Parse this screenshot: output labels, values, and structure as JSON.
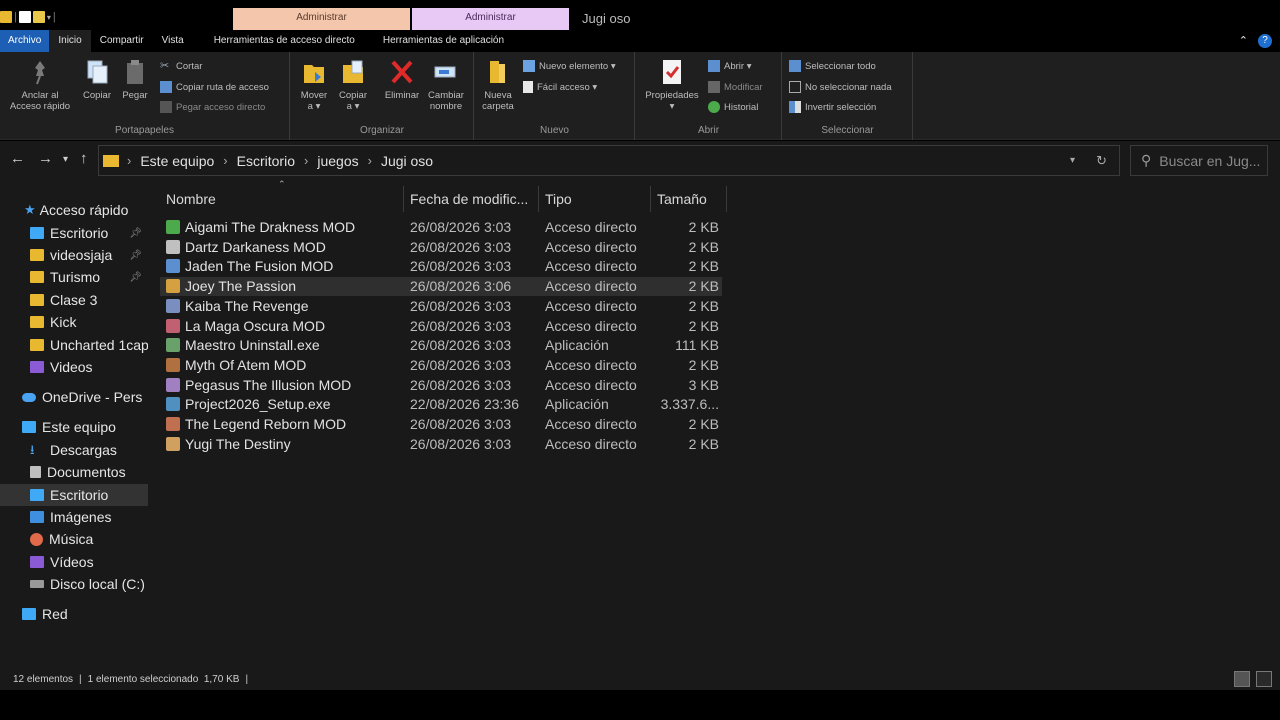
{
  "window": {
    "title": "Jugi oso",
    "context_tab_1": "Administrar",
    "context_tab_2": "Administrar"
  },
  "ribbon_tabs": [
    "Archivo",
    "Inicio",
    "Compartir",
    "Vista",
    "Herramientas de acceso directo",
    "Herramientas de aplicación"
  ],
  "ribbon": {
    "portapapeles": {
      "label": "Portapapeles",
      "pin": "Anclar al\nAcceso rápido",
      "pin_line1": "Anclar al",
      "pin_line2": "Acceso rápido",
      "copy": "Copiar",
      "paste": "Pegar",
      "cut": "Cortar",
      "copy_path": "Copiar ruta de acceso",
      "paste_shortcut": "Pegar acceso directo"
    },
    "organizar": {
      "label": "Organizar",
      "move_line1": "Mover",
      "move_line2": "a ▾",
      "copy_line1": "Copiar",
      "copy_line2": "a ▾",
      "delete": "Eliminar",
      "rename_line1": "Cambiar",
      "rename_line2": "nombre"
    },
    "nuevo": {
      "label": "Nuevo",
      "new_folder_line1": "Nueva",
      "new_folder_line2": "carpeta",
      "new_item": "Nuevo elemento ▾",
      "easy_access": "Fácil acceso ▾"
    },
    "abrir": {
      "label": "Abrir",
      "properties": "Propiedades",
      "open": "Abrir ▾",
      "edit": "Modificar",
      "history": "Historial"
    },
    "seleccionar": {
      "label": "Seleccionar",
      "select_all": "Seleccionar todo",
      "select_none": "No seleccionar nada",
      "invert": "Invertir selección"
    }
  },
  "breadcrumb": [
    "Este equipo",
    "Escritorio",
    "juegos",
    "Jugi oso"
  ],
  "search": {
    "placeholder": "Buscar en Jug..."
  },
  "nav_pane": {
    "quick_access": "Acceso rápido",
    "quick_items": [
      "Escritorio",
      "videosjaja",
      "Turismo",
      "Clase 3",
      "Kick",
      "Uncharted 1cap",
      "Videos"
    ],
    "onedrive": "OneDrive - Pers",
    "this_pc": "Este equipo",
    "pc_items": [
      "Descargas",
      "Documentos",
      "Escritorio",
      "Imágenes",
      "Música",
      "Vídeos",
      "Disco local (C:)"
    ],
    "network": "Red"
  },
  "columns": [
    "Nombre",
    "Fecha de modific...",
    "Tipo",
    "Tamaño"
  ],
  "files": [
    {
      "name": "Aigami The Drakness MOD",
      "date": "26/08/2026 3:03",
      "type": "Acceso directo",
      "size": "2 KB"
    },
    {
      "name": "Dartz Darkaness MOD",
      "date": "26/08/2026 3:03",
      "type": "Acceso directo",
      "size": "2 KB"
    },
    {
      "name": "Jaden The Fusion MOD",
      "date": "26/08/2026 3:03",
      "type": "Acceso directo",
      "size": "2 KB"
    },
    {
      "name": "Joey The Passion",
      "date": "26/08/2026 3:06",
      "type": "Acceso directo",
      "size": "2 KB"
    },
    {
      "name": "Kaiba The Revenge",
      "date": "26/08/2026 3:03",
      "type": "Acceso directo",
      "size": "2 KB"
    },
    {
      "name": "La Maga Oscura MOD",
      "date": "26/08/2026 3:03",
      "type": "Acceso directo",
      "size": "2 KB"
    },
    {
      "name": "Maestro Uninstall.exe",
      "date": "26/08/2026 3:03",
      "type": "Aplicación",
      "size": "111 KB"
    },
    {
      "name": "Myth Of Atem MOD",
      "date": "26/08/2026 3:03",
      "type": "Acceso directo",
      "size": "2 KB"
    },
    {
      "name": "Pegasus The Illusion MOD",
      "date": "26/08/2026 3:03",
      "type": "Acceso directo",
      "size": "3 KB"
    },
    {
      "name": "Project2026_Setup.exe",
      "date": "22/08/2026 23:36",
      "type": "Aplicación",
      "size": "3.337.6..."
    },
    {
      "name": "The Legend Reborn MOD",
      "date": "26/08/2026 3:03",
      "type": "Acceso directo",
      "size": "2 KB"
    },
    {
      "name": "Yugi The Destiny",
      "date": "26/08/2026 3:03",
      "type": "Acceso directo",
      "size": "2 KB"
    }
  ],
  "status": {
    "count": "12 elementos",
    "selection": "1 elemento seleccionado  1,70 KB"
  },
  "colors": {
    "file_tab": "#1c5fb4",
    "context_1": "#f4c7ac",
    "context_2": "#e8c8f4",
    "folder": "#e8b830",
    "background": "#191919"
  }
}
